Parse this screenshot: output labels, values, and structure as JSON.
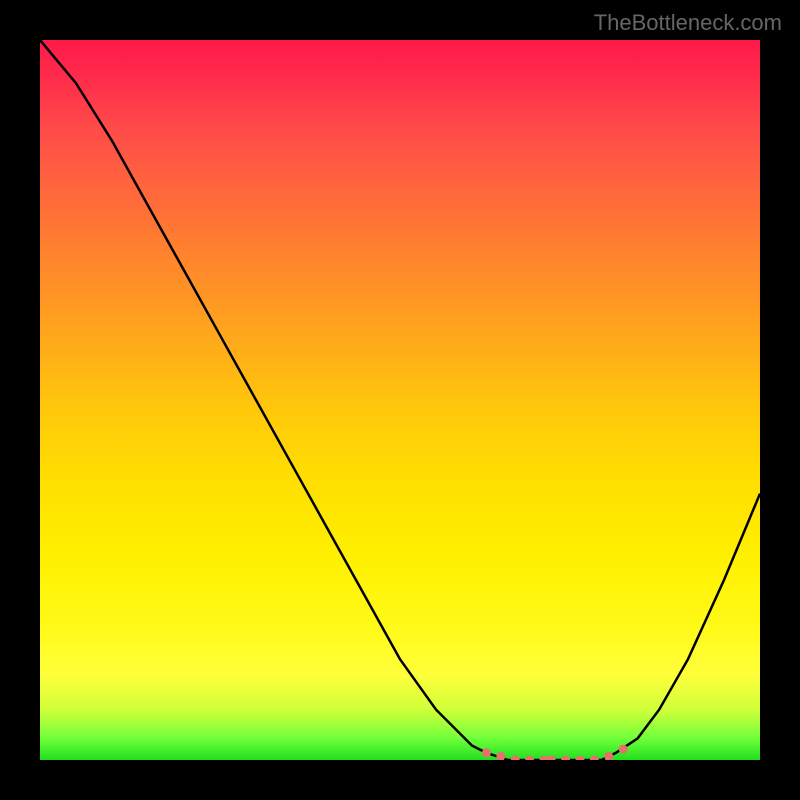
{
  "watermark": "TheBottleneck.com",
  "chart_data": {
    "type": "line",
    "title": "",
    "xlabel": "",
    "ylabel": "",
    "xlim": [
      0,
      100
    ],
    "ylim": [
      0,
      100
    ],
    "series": [
      {
        "name": "bottleneck-curve",
        "x": [
          0,
          5,
          10,
          15,
          20,
          25,
          30,
          35,
          40,
          45,
          50,
          55,
          60,
          62,
          65,
          68,
          70,
          72,
          75,
          78,
          80,
          83,
          86,
          90,
          95,
          100
        ],
        "y": [
          100,
          94,
          86,
          77,
          68,
          59,
          50,
          41,
          32,
          23,
          14,
          7,
          2,
          1,
          0,
          0,
          0,
          0,
          0,
          0,
          1,
          3,
          7,
          14,
          25,
          37
        ]
      }
    ],
    "highlight_dots": {
      "name": "optimal-range",
      "coords": [
        [
          62,
          1
        ],
        [
          64,
          0.5
        ],
        [
          66,
          0
        ],
        [
          68,
          0
        ],
        [
          70,
          0
        ],
        [
          71,
          0
        ],
        [
          73,
          0
        ],
        [
          75,
          0
        ],
        [
          77,
          0
        ],
        [
          79,
          0.5
        ],
        [
          81,
          1.5
        ]
      ],
      "color": "#e8706a"
    }
  }
}
